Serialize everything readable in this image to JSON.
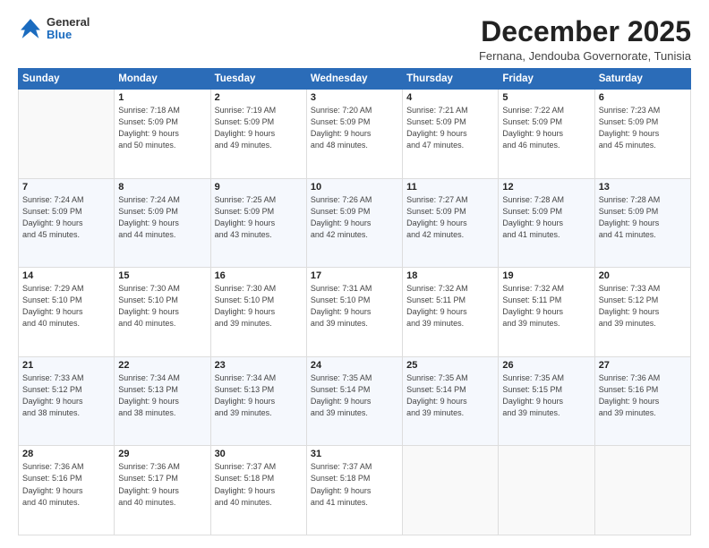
{
  "logo": {
    "general": "General",
    "blue": "Blue"
  },
  "header": {
    "month": "December 2025",
    "location": "Fernana, Jendouba Governorate, Tunisia"
  },
  "weekdays": [
    "Sunday",
    "Monday",
    "Tuesday",
    "Wednesday",
    "Thursday",
    "Friday",
    "Saturday"
  ],
  "weeks": [
    [
      {
        "day": "",
        "info": ""
      },
      {
        "day": "1",
        "info": "Sunrise: 7:18 AM\nSunset: 5:09 PM\nDaylight: 9 hours\nand 50 minutes."
      },
      {
        "day": "2",
        "info": "Sunrise: 7:19 AM\nSunset: 5:09 PM\nDaylight: 9 hours\nand 49 minutes."
      },
      {
        "day": "3",
        "info": "Sunrise: 7:20 AM\nSunset: 5:09 PM\nDaylight: 9 hours\nand 48 minutes."
      },
      {
        "day": "4",
        "info": "Sunrise: 7:21 AM\nSunset: 5:09 PM\nDaylight: 9 hours\nand 47 minutes."
      },
      {
        "day": "5",
        "info": "Sunrise: 7:22 AM\nSunset: 5:09 PM\nDaylight: 9 hours\nand 46 minutes."
      },
      {
        "day": "6",
        "info": "Sunrise: 7:23 AM\nSunset: 5:09 PM\nDaylight: 9 hours\nand 45 minutes."
      }
    ],
    [
      {
        "day": "7",
        "info": "Sunrise: 7:24 AM\nSunset: 5:09 PM\nDaylight: 9 hours\nand 45 minutes."
      },
      {
        "day": "8",
        "info": "Sunrise: 7:24 AM\nSunset: 5:09 PM\nDaylight: 9 hours\nand 44 minutes."
      },
      {
        "day": "9",
        "info": "Sunrise: 7:25 AM\nSunset: 5:09 PM\nDaylight: 9 hours\nand 43 minutes."
      },
      {
        "day": "10",
        "info": "Sunrise: 7:26 AM\nSunset: 5:09 PM\nDaylight: 9 hours\nand 42 minutes."
      },
      {
        "day": "11",
        "info": "Sunrise: 7:27 AM\nSunset: 5:09 PM\nDaylight: 9 hours\nand 42 minutes."
      },
      {
        "day": "12",
        "info": "Sunrise: 7:28 AM\nSunset: 5:09 PM\nDaylight: 9 hours\nand 41 minutes."
      },
      {
        "day": "13",
        "info": "Sunrise: 7:28 AM\nSunset: 5:09 PM\nDaylight: 9 hours\nand 41 minutes."
      }
    ],
    [
      {
        "day": "14",
        "info": "Sunrise: 7:29 AM\nSunset: 5:10 PM\nDaylight: 9 hours\nand 40 minutes."
      },
      {
        "day": "15",
        "info": "Sunrise: 7:30 AM\nSunset: 5:10 PM\nDaylight: 9 hours\nand 40 minutes."
      },
      {
        "day": "16",
        "info": "Sunrise: 7:30 AM\nSunset: 5:10 PM\nDaylight: 9 hours\nand 39 minutes."
      },
      {
        "day": "17",
        "info": "Sunrise: 7:31 AM\nSunset: 5:10 PM\nDaylight: 9 hours\nand 39 minutes."
      },
      {
        "day": "18",
        "info": "Sunrise: 7:32 AM\nSunset: 5:11 PM\nDaylight: 9 hours\nand 39 minutes."
      },
      {
        "day": "19",
        "info": "Sunrise: 7:32 AM\nSunset: 5:11 PM\nDaylight: 9 hours\nand 39 minutes."
      },
      {
        "day": "20",
        "info": "Sunrise: 7:33 AM\nSunset: 5:12 PM\nDaylight: 9 hours\nand 39 minutes."
      }
    ],
    [
      {
        "day": "21",
        "info": "Sunrise: 7:33 AM\nSunset: 5:12 PM\nDaylight: 9 hours\nand 38 minutes."
      },
      {
        "day": "22",
        "info": "Sunrise: 7:34 AM\nSunset: 5:13 PM\nDaylight: 9 hours\nand 38 minutes."
      },
      {
        "day": "23",
        "info": "Sunrise: 7:34 AM\nSunset: 5:13 PM\nDaylight: 9 hours\nand 39 minutes."
      },
      {
        "day": "24",
        "info": "Sunrise: 7:35 AM\nSunset: 5:14 PM\nDaylight: 9 hours\nand 39 minutes."
      },
      {
        "day": "25",
        "info": "Sunrise: 7:35 AM\nSunset: 5:14 PM\nDaylight: 9 hours\nand 39 minutes."
      },
      {
        "day": "26",
        "info": "Sunrise: 7:35 AM\nSunset: 5:15 PM\nDaylight: 9 hours\nand 39 minutes."
      },
      {
        "day": "27",
        "info": "Sunrise: 7:36 AM\nSunset: 5:16 PM\nDaylight: 9 hours\nand 39 minutes."
      }
    ],
    [
      {
        "day": "28",
        "info": "Sunrise: 7:36 AM\nSunset: 5:16 PM\nDaylight: 9 hours\nand 40 minutes."
      },
      {
        "day": "29",
        "info": "Sunrise: 7:36 AM\nSunset: 5:17 PM\nDaylight: 9 hours\nand 40 minutes."
      },
      {
        "day": "30",
        "info": "Sunrise: 7:37 AM\nSunset: 5:18 PM\nDaylight: 9 hours\nand 40 minutes."
      },
      {
        "day": "31",
        "info": "Sunrise: 7:37 AM\nSunset: 5:18 PM\nDaylight: 9 hours\nand 41 minutes."
      },
      {
        "day": "",
        "info": ""
      },
      {
        "day": "",
        "info": ""
      },
      {
        "day": "",
        "info": ""
      }
    ]
  ]
}
